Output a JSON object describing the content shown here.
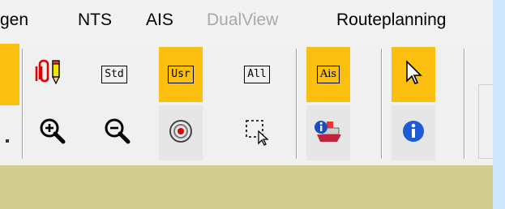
{
  "menu": {
    "items": [
      {
        "label": "gen",
        "enabled": true
      },
      {
        "label": "NTS",
        "enabled": true
      },
      {
        "label": "AIS",
        "enabled": true
      },
      {
        "label": "DualView",
        "enabled": false
      },
      {
        "label": "Routeplanning",
        "enabled": true
      }
    ]
  },
  "toolbar": {
    "std_label": "Std",
    "usr_label": "Usr",
    "all_label": "All",
    "ais_label": "Ais",
    "active_color": "#fbbf0f",
    "active_buttons": [
      "usr-layer-button",
      "ais-button",
      "pointer-tool-button"
    ],
    "icons": {
      "layers_edit": "clip-pencil-icon",
      "zoom_in": "zoom-in-icon",
      "zoom_out": "zoom-out-icon",
      "target": "target-icon",
      "select_area": "select-rectangle-icon",
      "ais_info": "ship-info-icon",
      "pointer": "pointer-icon",
      "info": "info-icon"
    }
  },
  "colors": {
    "background": "#cfe6fd",
    "menubar": "#f2f2f2",
    "toolbar": "#f0f0f0",
    "bottom_panel": "#d2cc90",
    "disabled_text": "#a8a8a8"
  }
}
